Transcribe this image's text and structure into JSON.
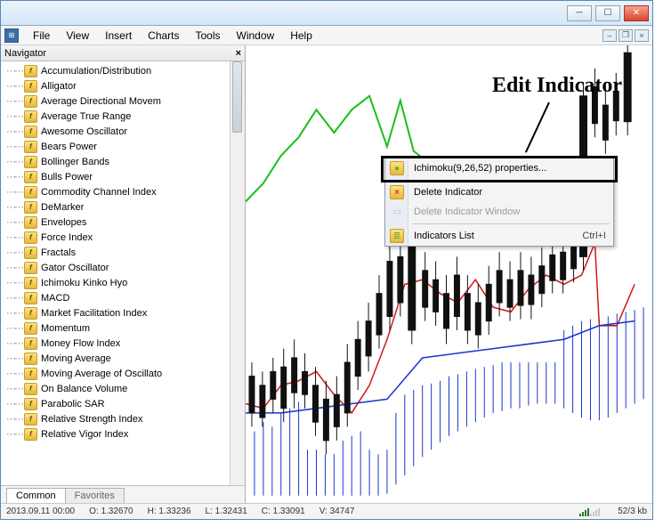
{
  "menubar": [
    "File",
    "View",
    "Insert",
    "Charts",
    "Tools",
    "Window",
    "Help"
  ],
  "navigator": {
    "title": "Navigator",
    "items": [
      "Accumulation/Distribution",
      "Alligator",
      "Average Directional Movem",
      "Average True Range",
      "Awesome Oscillator",
      "Bears Power",
      "Bollinger Bands",
      "Bulls Power",
      "Commodity Channel Index",
      "DeMarker",
      "Envelopes",
      "Force Index",
      "Fractals",
      "Gator Oscillator",
      "Ichimoku Kinko Hyo",
      "MACD",
      "Market Facilitation Index",
      "Momentum",
      "Money Flow Index",
      "Moving Average",
      "Moving Average of Oscillato",
      "On Balance Volume",
      "Parabolic SAR",
      "Relative Strength Index",
      "Relative Vigor Index"
    ],
    "tabs": {
      "active": "Common",
      "inactive": "Favorites"
    }
  },
  "context_menu": {
    "properties": "Ichimoku(9,26,52) properties...",
    "delete": "Delete Indicator",
    "delete_window": "Delete Indicator Window",
    "list": "Indicators List",
    "list_shortcut": "Ctrl+I"
  },
  "annotation": "Edit Indicator",
  "statusbar": {
    "date": "2013.09.11 00:00",
    "o": "O: 1.32670",
    "h": "H: 1.33236",
    "l": "L: 1.32431",
    "c": "C: 1.33091",
    "v": "V: 34747",
    "net": "52/3 kb"
  },
  "chart_data": {
    "type": "candlestick",
    "note": "Ichimoku overlay on price chart; values approximate, axes not shown",
    "x_range": [
      0,
      60
    ],
    "y_range": [
      1.318,
      1.344
    ],
    "lines": {
      "tenkan_sen_color": "#d01818",
      "kijun_sen_color": "#1836d0",
      "chikou_color": "#18d018",
      "cloud_hatch_color": "#1836d0",
      "candle_body_color": "#101010"
    },
    "candles_sample": [
      {
        "x": 2,
        "o": 1.325,
        "h": 1.327,
        "l": 1.322,
        "c": 1.324
      },
      {
        "x": 6,
        "o": 1.324,
        "h": 1.326,
        "l": 1.32,
        "c": 1.321
      },
      {
        "x": 10,
        "o": 1.321,
        "h": 1.323,
        "l": 1.318,
        "c": 1.322
      },
      {
        "x": 14,
        "o": 1.322,
        "h": 1.327,
        "l": 1.321,
        "c": 1.326
      },
      {
        "x": 18,
        "o": 1.326,
        "h": 1.328,
        "l": 1.322,
        "c": 1.323
      },
      {
        "x": 22,
        "o": 1.323,
        "h": 1.33,
        "l": 1.321,
        "c": 1.329
      },
      {
        "x": 30,
        "o": 1.329,
        "h": 1.336,
        "l": 1.328,
        "c": 1.335
      },
      {
        "x": 40,
        "o": 1.335,
        "h": 1.338,
        "l": 1.333,
        "c": 1.336
      },
      {
        "x": 56,
        "o": 1.332,
        "h": 1.344,
        "l": 1.331,
        "c": 1.343
      }
    ]
  }
}
